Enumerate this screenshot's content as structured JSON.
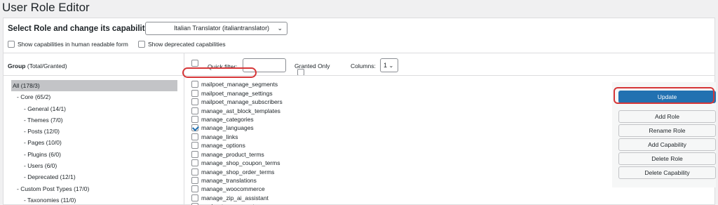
{
  "page": {
    "title": "User Role Editor"
  },
  "role": {
    "label": "Select Role and change its capabilities:",
    "selected": "Italian Translator (italiantranslator)",
    "options": [
      {
        "label": "Show capabilities in human readable form",
        "checked": false
      },
      {
        "label": "Show deprecated capabilities",
        "checked": false
      }
    ]
  },
  "groups": {
    "heading": "Group",
    "heading_suffix": "(Total/Granted)",
    "items": [
      {
        "label": "All (178/3)",
        "selected": true
      },
      {
        "label": "- Core (65/2)",
        "selected": false
      },
      {
        "label": "- General (14/1)",
        "selected": false
      },
      {
        "label": "- Themes (7/0)",
        "selected": false
      },
      {
        "label": "- Posts (12/0)",
        "selected": false
      },
      {
        "label": "- Pages (10/0)",
        "selected": false
      },
      {
        "label": "- Plugins (6/0)",
        "selected": false
      },
      {
        "label": "- Users (6/0)",
        "selected": false
      },
      {
        "label": "- Deprecated (12/1)",
        "selected": false
      },
      {
        "label": "- Custom Post Types (17/0)",
        "selected": false
      },
      {
        "label": "- Taxonomies (11/0)",
        "selected": false
      }
    ]
  },
  "filter": {
    "quick_filter_label": "Quick filter:",
    "quick_filter_value": "",
    "granted_only_label": "Granted Only",
    "columns_label": "Columns:",
    "columns_value": "1"
  },
  "capabilities": [
    {
      "name": "mailpoet_manage_segments",
      "checked": false
    },
    {
      "name": "mailpoet_manage_settings",
      "checked": false
    },
    {
      "name": "mailpoet_manage_subscribers",
      "checked": false
    },
    {
      "name": "manage_ast_block_templates",
      "checked": false
    },
    {
      "name": "manage_categories",
      "checked": false
    },
    {
      "name": "manage_languages",
      "checked": true
    },
    {
      "name": "manage_links",
      "checked": false
    },
    {
      "name": "manage_options",
      "checked": false
    },
    {
      "name": "manage_product_terms",
      "checked": false
    },
    {
      "name": "manage_shop_coupon_terms",
      "checked": false
    },
    {
      "name": "manage_shop_order_terms",
      "checked": false
    },
    {
      "name": "manage_translations",
      "checked": false
    },
    {
      "name": "manage_woocommerce",
      "checked": false
    },
    {
      "name": "manage_zip_ai_assistant",
      "checked": false
    },
    {
      "name": "moderate_comments",
      "checked": false
    }
  ],
  "actions": {
    "update": "Update",
    "add_role": "Add Role",
    "rename_role": "Rename Role",
    "add_capability": "Add Capability",
    "delete_role": "Delete Role",
    "delete_capability": "Delete Capability"
  },
  "colors": {
    "primary": "#2271b1",
    "highlight": "#d63638"
  }
}
